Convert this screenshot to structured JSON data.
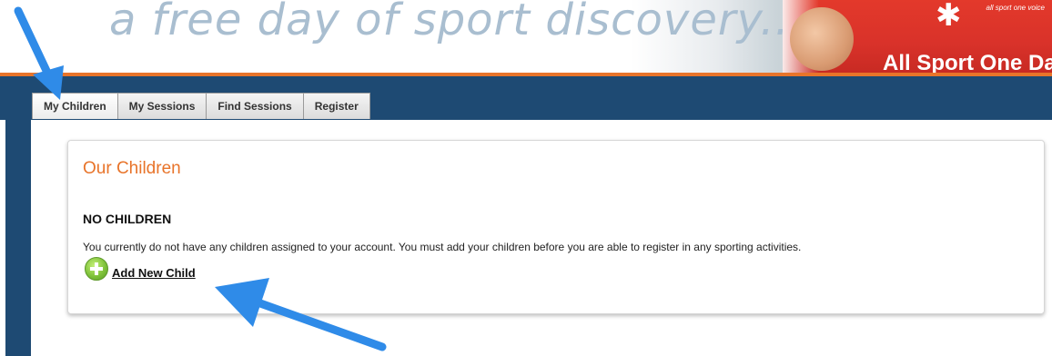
{
  "banner": {
    "tagline": "a free day of sport discovery...",
    "logo_small": "all sport one voice",
    "brand_text": "All Sport One Da"
  },
  "nav": {
    "tabs": [
      {
        "label": "My Children",
        "active": true
      },
      {
        "label": "My Sessions",
        "active": false
      },
      {
        "label": "Find Sessions",
        "active": false
      },
      {
        "label": "Register",
        "active": false
      }
    ]
  },
  "panel": {
    "title": "Our Children",
    "heading": "NO CHILDREN",
    "message": "You currently do not have any children assigned to your account. You must add your children before you are able to register in any sporting activities.",
    "add_link": "Add New Child"
  },
  "colors": {
    "accent_orange": "#e8742a",
    "nav_blue": "#1e4a73",
    "annotation_blue": "#2f8be8"
  },
  "icons": {
    "add": "plus-circle-icon",
    "annotation": "arrow-annotation"
  }
}
